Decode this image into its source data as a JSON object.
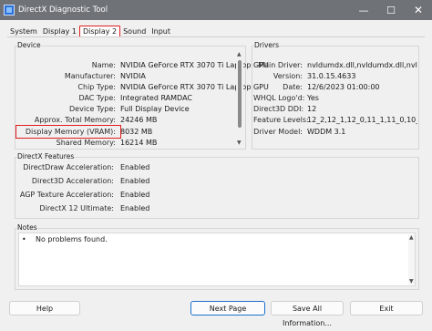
{
  "window": {
    "title": "DirectX Diagnostic Tool"
  },
  "tabs": [
    {
      "label": "System"
    },
    {
      "label": "Display 1"
    },
    {
      "label": "Display 2"
    },
    {
      "label": "Sound"
    },
    {
      "label": "Input"
    }
  ],
  "device": {
    "title": "Device",
    "rows": [
      {
        "label": "Name:",
        "value": "NVIDIA GeForce RTX 3070 Ti Laptop GPU"
      },
      {
        "label": "Manufacturer:",
        "value": "NVIDIA"
      },
      {
        "label": "Chip Type:",
        "value": "NVIDIA GeForce RTX 3070 Ti Laptop GPU"
      },
      {
        "label": "DAC Type:",
        "value": "Integrated RAMDAC"
      },
      {
        "label": "Device Type:",
        "value": "Full Display Device"
      },
      {
        "label": "Approx. Total Memory:",
        "value": "24246 MB"
      },
      {
        "label": "Display Memory (VRAM):",
        "value": "8032 MB"
      },
      {
        "label": "Shared Memory:",
        "value": "16214 MB"
      }
    ]
  },
  "drivers": {
    "title": "Drivers",
    "rows": [
      {
        "label": "Main Driver:",
        "value": "nvldumdx.dll,nvldumdx.dll,nvldumdx.dll,n"
      },
      {
        "label": "Version:",
        "value": "31.0.15.4633"
      },
      {
        "label": "Date:",
        "value": "12/6/2023 01:00:00"
      },
      {
        "label": "WHQL Logo'd:",
        "value": "Yes"
      },
      {
        "label": "Direct3D DDI:",
        "value": "12"
      },
      {
        "label": "Feature Levels:",
        "value": "12_2,12_1,12_0,11_1,11_0,10_"
      },
      {
        "label": "Driver Model:",
        "value": "WDDM 3.1"
      }
    ]
  },
  "features": {
    "title": "DirectX Features",
    "rows": [
      {
        "label": "DirectDraw Acceleration:",
        "value": "Enabled"
      },
      {
        "label": "Direct3D Acceleration:",
        "value": "Enabled"
      },
      {
        "label": "AGP Texture Acceleration:",
        "value": "Enabled"
      },
      {
        "label": "DirectX 12 Ultimate:",
        "value": "Enabled"
      }
    ]
  },
  "notes": {
    "title": "Notes",
    "items": [
      {
        "bullet": "•",
        "text": "No problems found."
      }
    ]
  },
  "buttons": {
    "help": "Help",
    "next_page": "Next Page",
    "save_all": "Save All Information...",
    "exit": "Exit"
  },
  "colors": {
    "titlebar": "#6f7378",
    "highlight": "#e11d1d",
    "primary_border": "#1c6fcf"
  },
  "icons": {
    "minimize": "—",
    "maximize": "☐",
    "close": "✕",
    "scroll_up": "▲",
    "scroll_down": "▼"
  }
}
